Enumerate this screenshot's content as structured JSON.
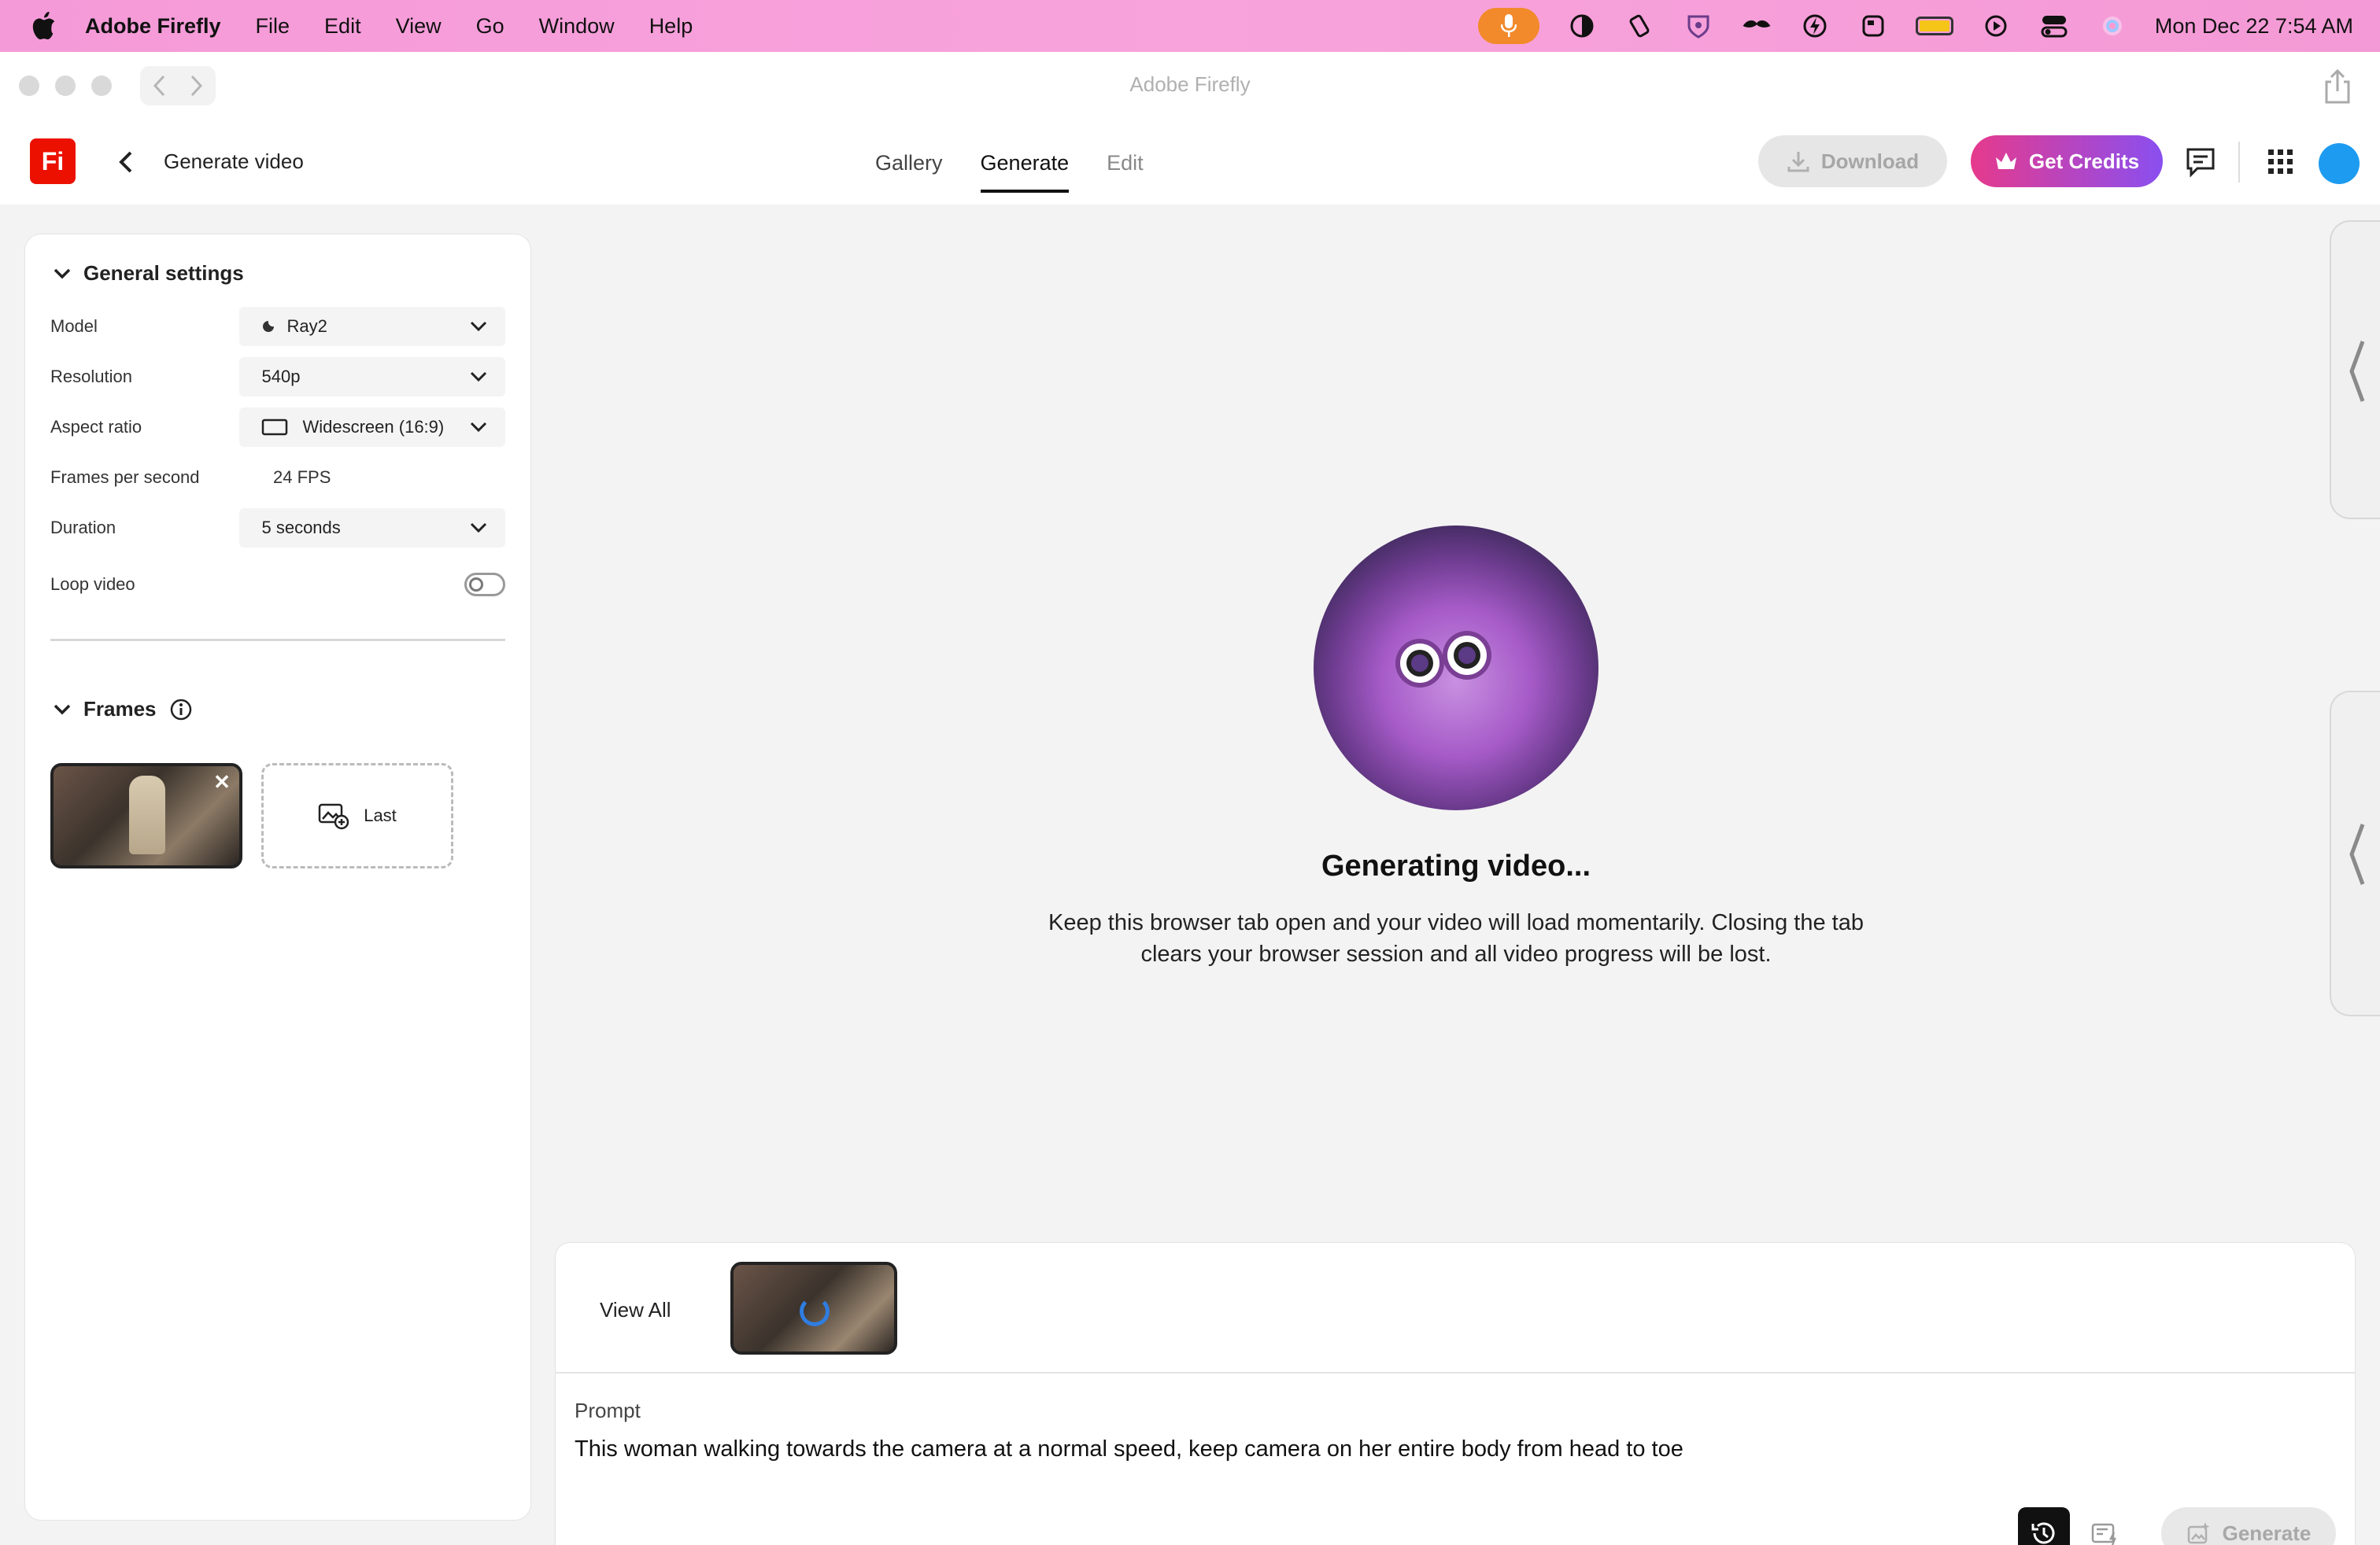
{
  "menubar": {
    "app_name": "Adobe Firefly",
    "items": [
      "File",
      "Edit",
      "View",
      "Go",
      "Window",
      "Help"
    ],
    "clock": "Mon Dec 22  7:54 AM"
  },
  "window": {
    "title": "Adobe Firefly"
  },
  "header": {
    "logo": "Fi",
    "page_title": "Generate video",
    "tabs": [
      "Gallery",
      "Generate",
      "Edit"
    ],
    "active_tab": "Generate",
    "download_label": "Download",
    "credits_label": "Get Credits"
  },
  "settings": {
    "general_title": "General settings",
    "model": {
      "label": "Model",
      "value": "Ray2"
    },
    "resolution": {
      "label": "Resolution",
      "value": "540p"
    },
    "aspect": {
      "label": "Aspect ratio",
      "value": "Widescreen (16:9)"
    },
    "fps": {
      "label": "Frames per second",
      "value": "24 FPS"
    },
    "duration": {
      "label": "Duration",
      "value": "5 seconds"
    },
    "loop": {
      "label": "Loop video",
      "on": false
    },
    "frames_title": "Frames",
    "last_frame_label": "Last"
  },
  "status": {
    "title": "Generating video...",
    "message": "Keep this browser tab open and your video will load momentarily. Closing the tab clears your browser session and all video progress will be lost."
  },
  "bottom": {
    "view_all": "View All",
    "prompt_label": "Prompt",
    "prompt_text": "This woman walking towards the camera at a normal speed, keep camera on her entire body from head to toe",
    "generate_label": "Generate"
  },
  "colors": {
    "menubar_pink": "#f8a3dc",
    "brand_red": "#eb1000",
    "credits_gradient_start": "#e63a8c",
    "credits_gradient_end": "#8a4ff0",
    "mic_orange": "#f28a2b"
  }
}
